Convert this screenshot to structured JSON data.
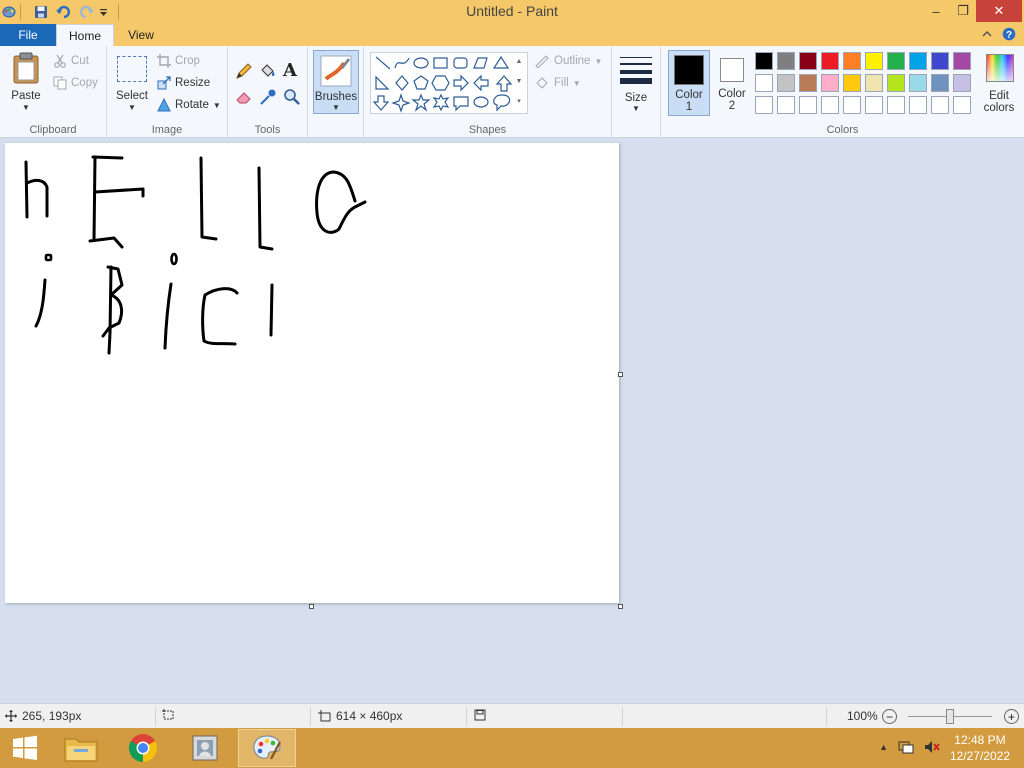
{
  "window": {
    "title": "Untitled - Paint",
    "controls": {
      "minimize": "–",
      "maximize": "❐",
      "close": "✕"
    }
  },
  "tabs": {
    "file": "File",
    "home": "Home",
    "view": "View"
  },
  "ribbon": {
    "clipboard": {
      "label": "Clipboard",
      "paste": "Paste",
      "cut": "Cut",
      "copy": "Copy"
    },
    "image": {
      "label": "Image",
      "select": "Select",
      "crop": "Crop",
      "resize": "Resize",
      "rotate": "Rotate"
    },
    "tools": {
      "label": "Tools"
    },
    "brushes": {
      "label": "Brushes"
    },
    "shapes": {
      "label": "Shapes",
      "outline": "Outline",
      "fill": "Fill"
    },
    "size": {
      "label": "Size"
    },
    "color1": {
      "line1": "Color",
      "line2": "1"
    },
    "color2": {
      "line1": "Color",
      "line2": "2"
    },
    "colors": {
      "label": "Colors",
      "edit_line1": "Edit",
      "edit_line2": "colors",
      "row1": [
        "#000000",
        "#7f7f7f",
        "#880015",
        "#ed1c24",
        "#ff7f27",
        "#fff200",
        "#22b14c",
        "#00a2e8",
        "#3f48cc",
        "#a349a4"
      ],
      "row2": [
        "#ffffff",
        "#c3c3c3",
        "#b97a57",
        "#ffaec9",
        "#ffc90e",
        "#efe4b0",
        "#b5e61d",
        "#99d9ea",
        "#7092be",
        "#c8bfe7"
      ],
      "row3": [
        "#ffffff",
        "#ffffff",
        "#ffffff",
        "#ffffff",
        "#ffffff",
        "#ffffff",
        "#ffffff",
        "#ffffff",
        "#ffffff",
        "#ffffff"
      ]
    }
  },
  "status": {
    "cursor_pos": "265, 193px",
    "canvas_size": "614 × 460px",
    "zoom": "100%"
  },
  "taskbar": {
    "time": "12:48 PM",
    "date": "12/27/2022"
  }
}
